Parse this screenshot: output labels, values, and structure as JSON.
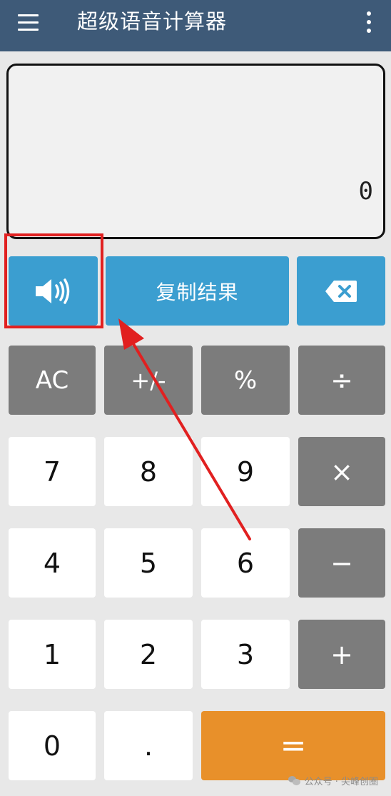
{
  "app": {
    "title": "超级语音计算器",
    "menu_icon": "hamburger-menu-icon",
    "overflow_icon": "more-vertical-icon"
  },
  "display": {
    "value": "0"
  },
  "actions": {
    "speaker_icon": "speaker-volume-icon",
    "copy_label": "复制结果",
    "backspace_icon": "backspace-icon"
  },
  "keys": {
    "ac": "AC",
    "plus_minus": "+/-",
    "percent": "%",
    "divide": "÷",
    "seven": "7",
    "eight": "8",
    "nine": "9",
    "multiply": "×",
    "four": "4",
    "five": "5",
    "six": "6",
    "minus": "−",
    "one": "1",
    "two": "2",
    "three": "3",
    "plus": "+",
    "zero": "0",
    "dot": ".",
    "equals": "="
  },
  "annotation": {
    "highlight_color": "#e12020",
    "arrow_color": "#e12020"
  },
  "watermark": {
    "text": "公众号 · 尖峰创圈",
    "icon": "wechat-icon"
  },
  "colors": {
    "app_bar": "#3e5a78",
    "blue_key": "#3b9ed0",
    "gray_key": "#7c7c7c",
    "white_key": "#ffffff",
    "equals_key": "#e8902a",
    "background": "#e8e8e8"
  }
}
